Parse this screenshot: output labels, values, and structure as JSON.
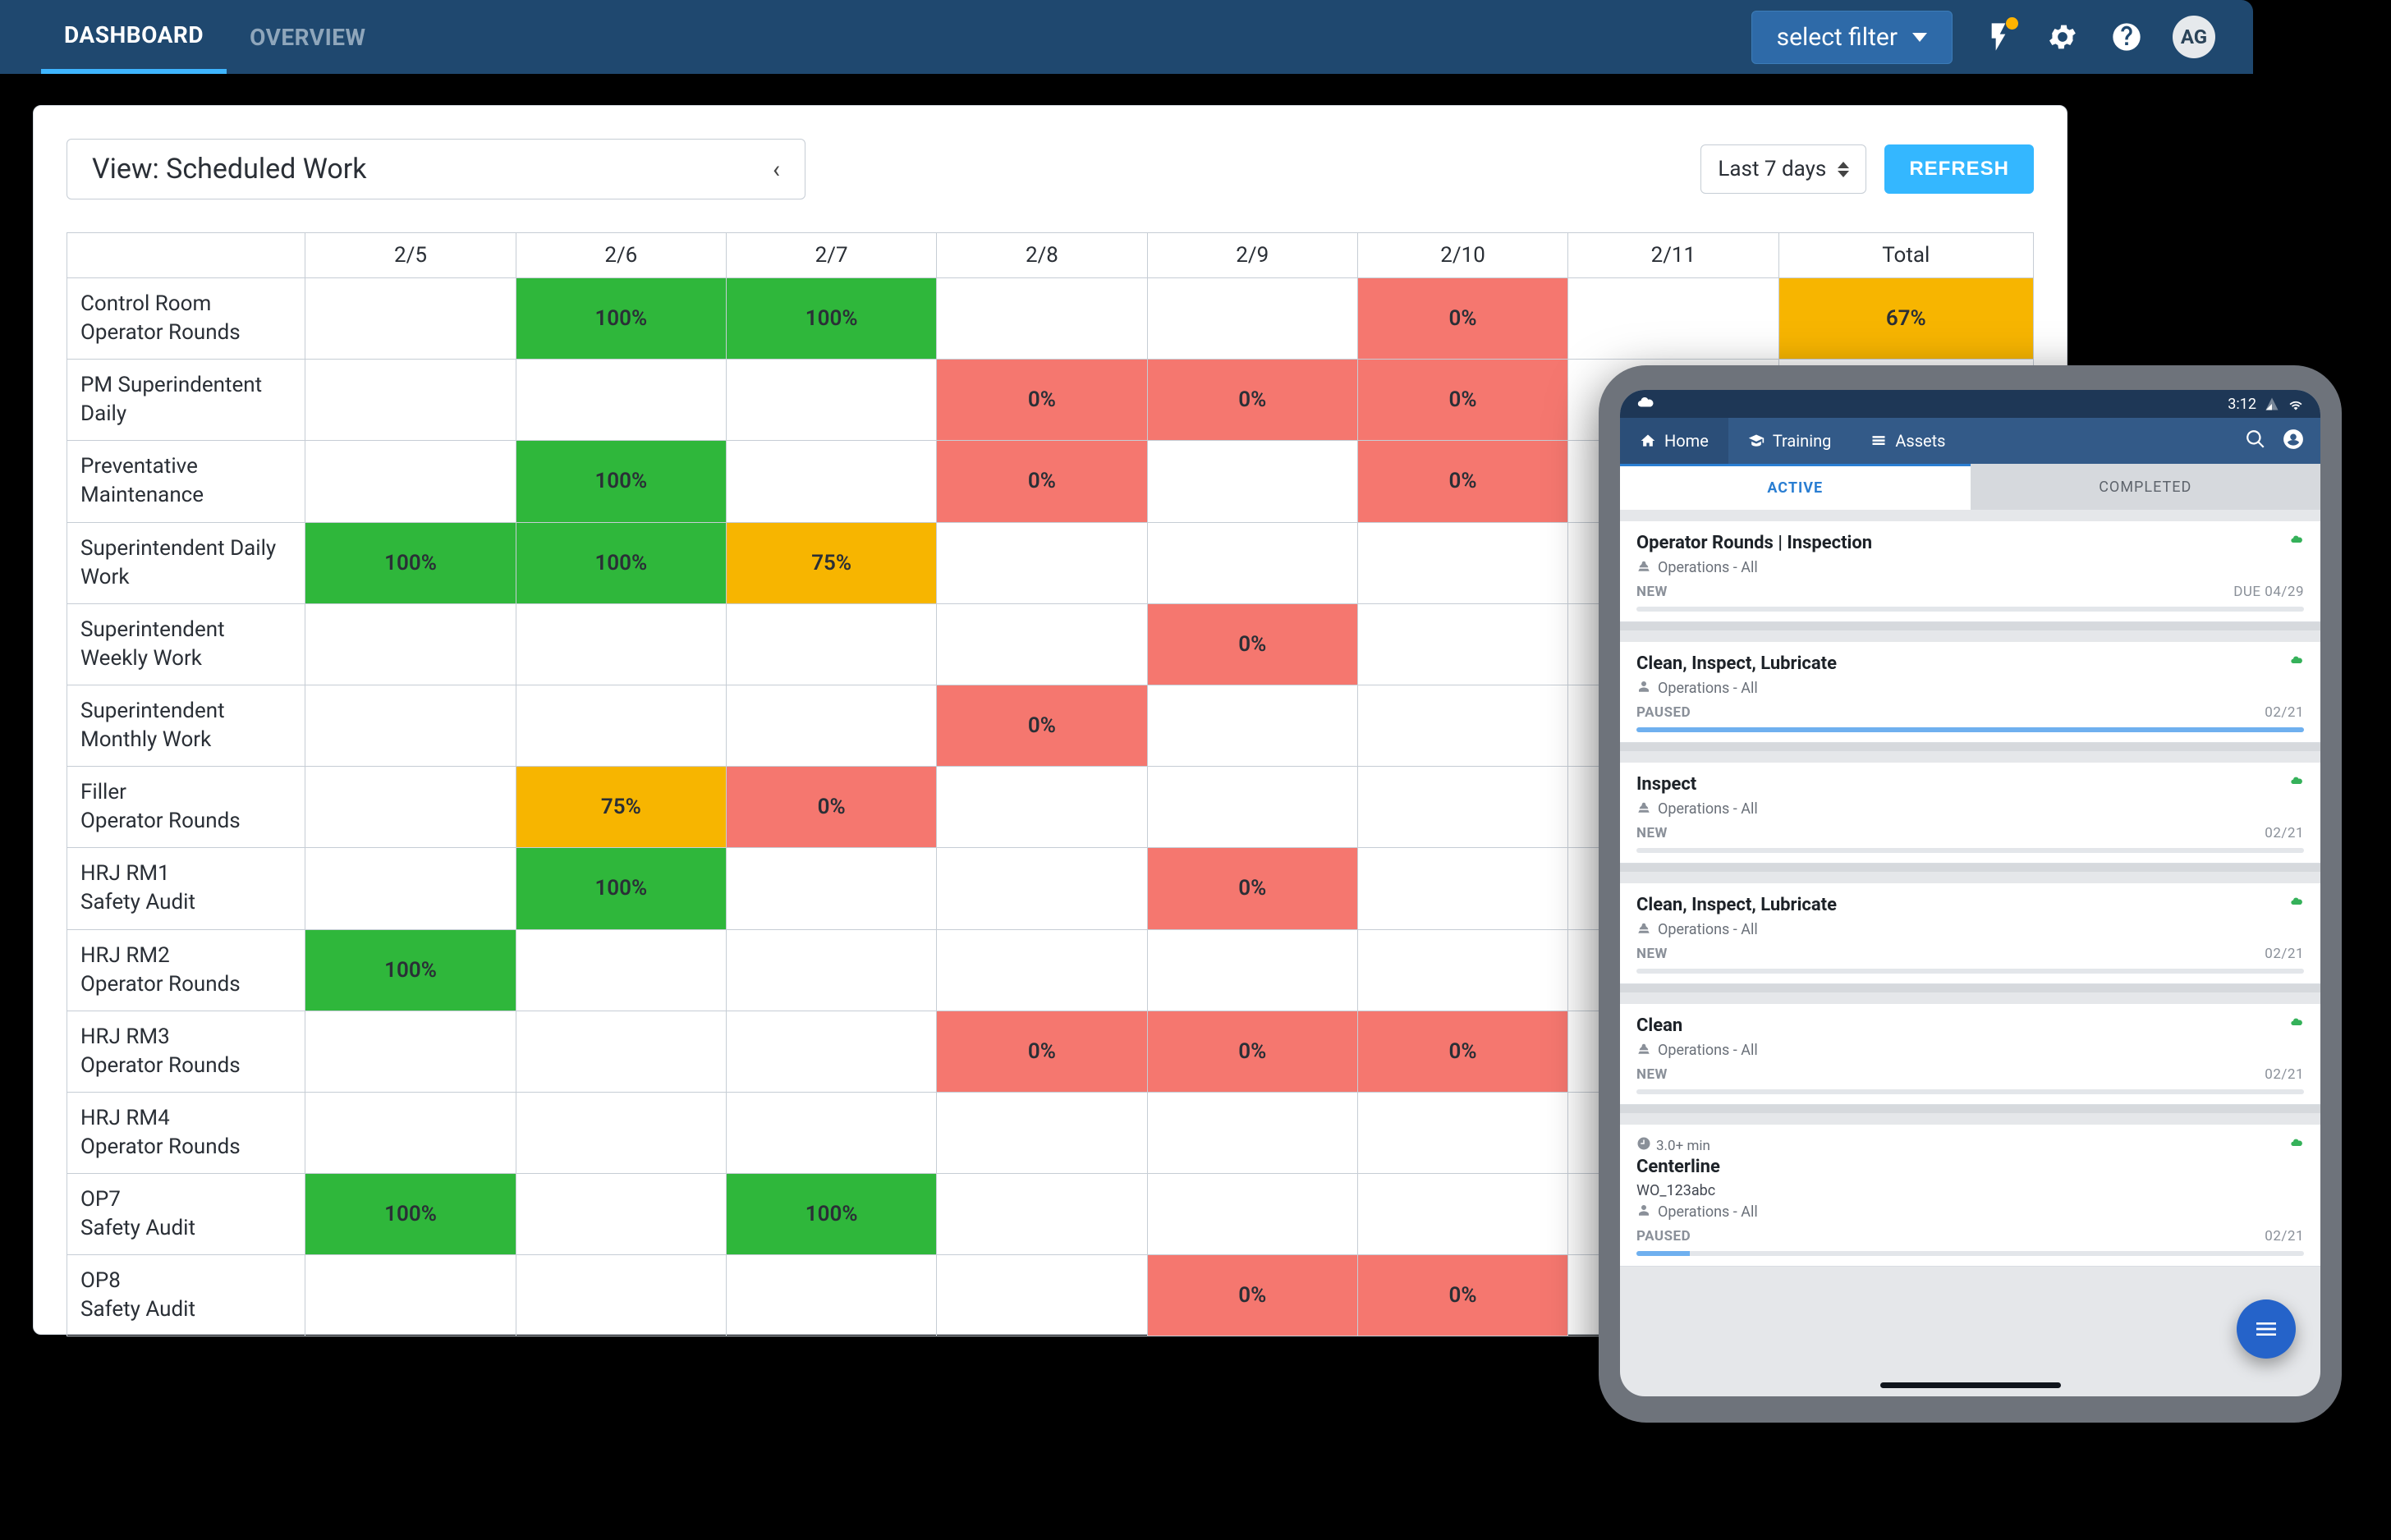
{
  "header": {
    "tabs": [
      "DASHBOARD",
      "OVERVIEW"
    ],
    "active_tab_index": 0,
    "filter_label": "select filter",
    "avatar_initials": "AG"
  },
  "card": {
    "view_label": "View: Scheduled Work",
    "range_label": "Last 7 days",
    "refresh_label": "REFRESH"
  },
  "grid": {
    "columns": [
      "2/5",
      "2/6",
      "2/7",
      "2/8",
      "2/9",
      "2/10",
      "2/11",
      "Total"
    ],
    "rows": [
      {
        "label_a": "Control Room",
        "label_b": "Operator Rounds",
        "cells": [
          "",
          "100%",
          "100%",
          "",
          "",
          "0%",
          "",
          "67%"
        ]
      },
      {
        "label_a": "PM Superindentent",
        "label_b": "Daily",
        "cells": [
          "",
          "",
          "",
          "0%",
          "0%",
          "0%",
          "",
          ""
        ]
      },
      {
        "label_a": "Preventative",
        "label_b": "Maintenance",
        "cells": [
          "",
          "100%",
          "",
          "0%",
          "",
          "0%",
          "",
          ""
        ]
      },
      {
        "label_a": "Superintendent Daily",
        "label_b": "Work",
        "cells": [
          "100%",
          "100%",
          "75%",
          "",
          "",
          "",
          "",
          ""
        ]
      },
      {
        "label_a": "Superintendent",
        "label_b": "Weekly Work",
        "cells": [
          "",
          "",
          "",
          "",
          "0%",
          "",
          "",
          ""
        ]
      },
      {
        "label_a": "Superintendent",
        "label_b": "Monthly Work",
        "cells": [
          "",
          "",
          "",
          "0%",
          "",
          "",
          "",
          ""
        ]
      },
      {
        "label_a": "Filler",
        "label_b": "Operator Rounds",
        "cells": [
          "",
          "75%",
          "0%",
          "",
          "",
          "",
          "",
          ""
        ]
      },
      {
        "label_a": "HRJ RM1",
        "label_b": "Safety Audit",
        "cells": [
          "",
          "100%",
          "",
          "",
          "0%",
          "",
          "",
          ""
        ]
      },
      {
        "label_a": "HRJ RM2",
        "label_b": "Operator Rounds",
        "cells": [
          "100%",
          "",
          "",
          "",
          "",
          "",
          "",
          ""
        ]
      },
      {
        "label_a": "HRJ RM3",
        "label_b": "Operator Rounds",
        "cells": [
          "",
          "",
          "",
          "0%",
          "0%",
          "0%",
          "",
          ""
        ]
      },
      {
        "label_a": "HRJ RM4",
        "label_b": "Operator Rounds",
        "cells": [
          "",
          "",
          "",
          "",
          "",
          "",
          "",
          ""
        ]
      },
      {
        "label_a": "OP7",
        "label_b": "Safety Audit",
        "cells": [
          "100%",
          "",
          "100%",
          "",
          "",
          "",
          "",
          ""
        ]
      },
      {
        "label_a": "OP8",
        "label_b": "Safety Audit",
        "cells": [
          "",
          "",
          "",
          "",
          "0%",
          "0%",
          "",
          ""
        ]
      }
    ]
  },
  "tablet": {
    "status_time": "3:12",
    "nav": {
      "home": "Home",
      "training": "Training",
      "assets": "Assets"
    },
    "seg_active": "ACTIVE",
    "seg_completed": "COMPLETED",
    "tasks": [
      {
        "title": "Operator Rounds | Inspection",
        "dept": "Operations - All",
        "dept_icon": "hazard",
        "status": "NEW",
        "right": "DUE 04/29",
        "progress": 0
      },
      {
        "title": "Clean, Inspect, Lubricate",
        "dept": "Operations - All",
        "dept_icon": "person",
        "status": "PAUSED",
        "right": "02/21",
        "progress": 100
      },
      {
        "title": "Inspect",
        "dept": "Operations - All",
        "dept_icon": "hazard",
        "status": "NEW",
        "right": "02/21",
        "progress": 0
      },
      {
        "title": "Clean, Inspect, Lubricate",
        "dept": "Operations - All",
        "dept_icon": "hazard",
        "status": "NEW",
        "right": "02/21",
        "progress": 0
      },
      {
        "title": "Clean",
        "dept": "Operations - All",
        "dept_icon": "hazard",
        "status": "NEW",
        "right": "02/21",
        "progress": 0
      },
      {
        "title": "Centerline",
        "eta": "3.0+ min",
        "wo": "WO_123abc",
        "dept": "Operations - All",
        "dept_icon": "person",
        "status": "PAUSED",
        "right": "02/21",
        "progress": 8
      }
    ]
  },
  "chart_data": {
    "type": "heatmap",
    "title": "View: Scheduled Work",
    "xlabel": "",
    "ylabel": "",
    "categories_x": [
      "2/5",
      "2/6",
      "2/7",
      "2/8",
      "2/9",
      "2/10",
      "2/11",
      "Total"
    ],
    "categories_y": [
      "Control Room Operator Rounds",
      "PM Superindentent Daily",
      "Preventative Maintenance",
      "Superintendent Daily Work",
      "Superintendent Weekly Work",
      "Superintendent Monthly Work",
      "Filler Operator Rounds",
      "HRJ RM1 Safety Audit",
      "HRJ RM2 Operator Rounds",
      "HRJ RM3 Operator Rounds",
      "HRJ RM4 Operator Rounds",
      "OP7 Safety Audit",
      "OP8 Safety Audit"
    ],
    "values": [
      [
        null,
        100,
        100,
        null,
        null,
        0,
        null,
        67
      ],
      [
        null,
        null,
        null,
        0,
        0,
        0,
        null,
        null
      ],
      [
        null,
        100,
        null,
        0,
        null,
        0,
        null,
        null
      ],
      [
        100,
        100,
        75,
        null,
        null,
        null,
        null,
        null
      ],
      [
        null,
        null,
        null,
        null,
        0,
        null,
        null,
        null
      ],
      [
        null,
        null,
        null,
        0,
        null,
        null,
        null,
        null
      ],
      [
        null,
        75,
        0,
        null,
        null,
        null,
        null,
        null
      ],
      [
        null,
        100,
        null,
        null,
        0,
        null,
        null,
        null
      ],
      [
        100,
        null,
        null,
        null,
        null,
        null,
        null,
        null
      ],
      [
        null,
        null,
        null,
        0,
        0,
        0,
        null,
        null
      ],
      [
        null,
        null,
        null,
        null,
        null,
        null,
        null,
        null
      ],
      [
        100,
        null,
        100,
        null,
        null,
        null,
        null,
        null
      ],
      [
        null,
        null,
        null,
        null,
        0,
        0,
        null,
        null
      ]
    ],
    "scale": {
      "0": "#f5776f",
      "1-99": "#f7b500",
      "100": "#2fb73b"
    },
    "unit": "%"
  }
}
